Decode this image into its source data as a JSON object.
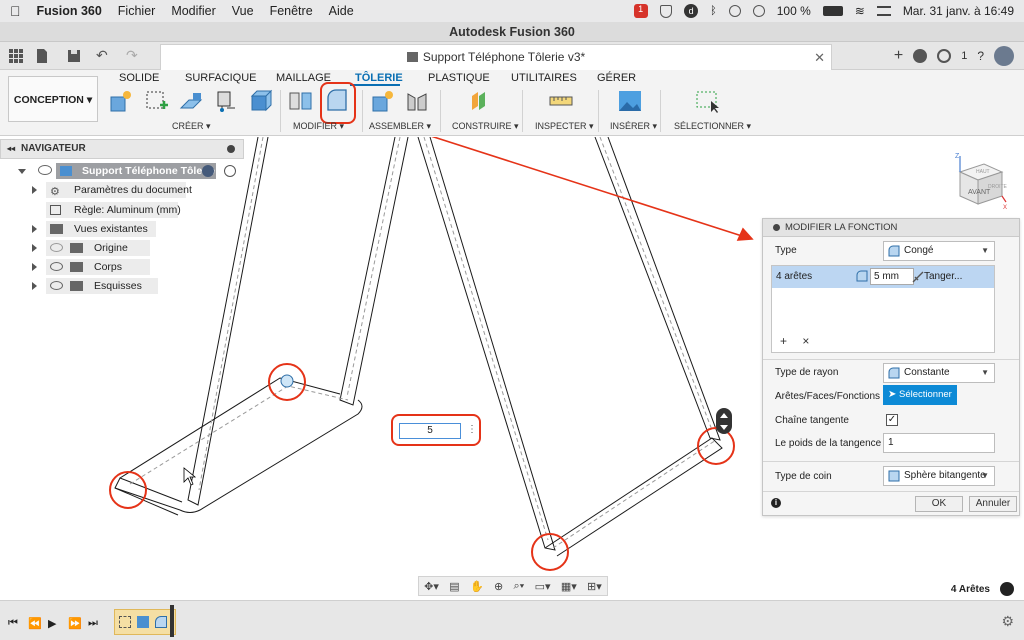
{
  "menubar": {
    "app": "Fusion 360",
    "items": [
      "Fichier",
      "Modifier",
      "Vue",
      "Fenêtre",
      "Aide"
    ],
    "battery": "100 %",
    "datetime": "Mar. 31 janv. à  16:49",
    "badge": "1"
  },
  "window": {
    "title": "Autodesk Fusion 360"
  },
  "document": {
    "tab_title": "Support Téléphone Tôlerie v3*",
    "jobs_count": "1"
  },
  "ribbon": {
    "workspace": "CONCEPTION",
    "tabs": [
      "SOLIDE",
      "SURFACIQUE",
      "MAILLAGE",
      "TÔLERIE",
      "PLASTIQUE",
      "UTILITAIRES",
      "GÉRER"
    ],
    "active_tab": "TÔLERIE",
    "groups": [
      "CRÉER",
      "MODIFIER",
      "ASSEMBLER",
      "CONSTRUIRE",
      "INSPECTER",
      "INSÉRER",
      "SÉLECTIONNER"
    ]
  },
  "navigator": {
    "title": "NAVIGATEUR",
    "root": "Support Téléphone Tôlerie",
    "items": [
      {
        "label": "Paramètres du document"
      },
      {
        "label": "Règle: Aluminum (mm)"
      },
      {
        "label": "Vues existantes"
      },
      {
        "label": "Origine"
      },
      {
        "label": "Corps"
      },
      {
        "label": "Esquisses"
      }
    ]
  },
  "dimension_input": {
    "value": "5"
  },
  "panel": {
    "title": "MODIFIER LA FONCTION",
    "type_label": "Type",
    "type_value": "Congé",
    "edges_label": "4 arêtes",
    "edges_radius": "5 mm",
    "edges_tangent": "Tanger...",
    "radius_type_label": "Type de rayon",
    "radius_type_value": "Constante",
    "select_label": "Arêtes/Faces/Fonctions",
    "select_button": "Sélectionner",
    "tangent_chain_label": "Chaîne tangente",
    "tangent_chain_checked": true,
    "tangent_weight_label": "Le poids de la tangence",
    "tangent_weight_value": "1",
    "corner_type_label": "Type de coin",
    "corner_type_value": "Sphère bitangente",
    "ok": "OK",
    "cancel": "Annuler"
  },
  "viewcube": {
    "face": "AVANT",
    "top": "HAUT",
    "right": "DROITE",
    "axis_z": "Z",
    "axis_x": "X"
  },
  "status": {
    "selection": "4 Arêtes"
  },
  "colors": {
    "accent": "#0a6fb3",
    "highlight": "#e53318",
    "select_button": "#0d8ad6"
  }
}
